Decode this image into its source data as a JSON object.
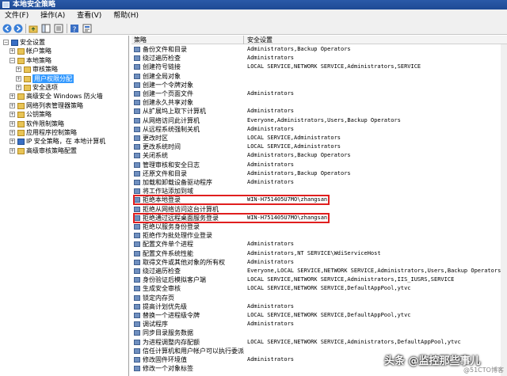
{
  "window": {
    "title": "本地安全策略"
  },
  "menu": [
    {
      "label": "文件(F)"
    },
    {
      "label": "操作(A)"
    },
    {
      "label": "查看(V)"
    },
    {
      "label": "帮助(H)"
    }
  ],
  "toolbar": {
    "icons": [
      "back-arrow",
      "forward-arrow",
      "up-folder",
      "show-tree",
      "export-list",
      "help",
      "properties"
    ]
  },
  "tree": [
    {
      "label": "安全设置",
      "level": 0,
      "expanded": true,
      "icon": "shield"
    },
    {
      "label": "帐户策略",
      "level": 1,
      "expanded": false,
      "icon": "folder"
    },
    {
      "label": "本地策略",
      "level": 1,
      "expanded": true,
      "icon": "folder"
    },
    {
      "label": "审核策略",
      "level": 2,
      "expanded": false,
      "icon": "folder"
    },
    {
      "label": "用户权限分配",
      "level": 2,
      "expanded": false,
      "icon": "folder",
      "selected": true
    },
    {
      "label": "安全选项",
      "level": 2,
      "expanded": false,
      "icon": "folder"
    },
    {
      "label": "高级安全 Windows 防火墙",
      "level": 1,
      "expanded": false,
      "icon": "folder"
    },
    {
      "label": "网络列表管理器策略",
      "level": 1,
      "expanded": false,
      "icon": "folder"
    },
    {
      "label": "公钥策略",
      "level": 1,
      "expanded": false,
      "icon": "folder"
    },
    {
      "label": "软件限制策略",
      "level": 1,
      "expanded": false,
      "icon": "folder"
    },
    {
      "label": "应用程序控制策略",
      "level": 1,
      "expanded": false,
      "icon": "folder"
    },
    {
      "label": "IP 安全策略，在 本地计算机",
      "level": 1,
      "expanded": false,
      "icon": "shield"
    },
    {
      "label": "高级审核策略配置",
      "level": 1,
      "expanded": false,
      "icon": "folder"
    }
  ],
  "list": {
    "columns": [
      "策略",
      "安全设置"
    ],
    "rows": [
      {
        "policy": "备份文件和目录",
        "setting": "Administrators,Backup Operators"
      },
      {
        "policy": "绕过遍历检查",
        "setting": "Administrators"
      },
      {
        "policy": "创建符号链接",
        "setting": "LOCAL SERVICE,NETWORK SERVICE,Administrators,SERVICE"
      },
      {
        "policy": "创建全局对象",
        "setting": ""
      },
      {
        "policy": "创建一个令牌对象",
        "setting": ""
      },
      {
        "policy": "创建一个页面文件",
        "setting": "Administrators"
      },
      {
        "policy": "创建永久共享对象",
        "setting": ""
      },
      {
        "policy": "从扩展坞上取下计算机",
        "setting": "Administrators"
      },
      {
        "policy": "从网络访问此计算机",
        "setting": "Everyone,Administrators,Users,Backup Operators"
      },
      {
        "policy": "从远程系统强制关机",
        "setting": "Administrators"
      },
      {
        "policy": "更改时区",
        "setting": "LOCAL SERVICE,Administrators"
      },
      {
        "policy": "更改系统时间",
        "setting": "LOCAL SERVICE,Administrators"
      },
      {
        "policy": "关闭系统",
        "setting": "Administrators,Backup Operators"
      },
      {
        "policy": "管理审核和安全日志",
        "setting": "Administrators"
      },
      {
        "policy": "还原文件和目录",
        "setting": "Administrators,Backup Operators"
      },
      {
        "policy": "加载和卸载设备驱动程序",
        "setting": "Administrators"
      },
      {
        "policy": "将工作站添加到域",
        "setting": ""
      },
      {
        "policy": "拒绝本地登录",
        "setting": "WIN-H751405U7MO\\zhangsan"
      },
      {
        "policy": "拒绝从网络访问这台计算机",
        "setting": ""
      },
      {
        "policy": "拒绝通过远程桌面服务登录",
        "setting": "WIN-H751405U7MO\\zhangsan"
      },
      {
        "policy": "拒绝以服务身份登录",
        "setting": ""
      },
      {
        "policy": "拒绝作为批处理作业登录",
        "setting": ""
      },
      {
        "policy": "配置文件单个进程",
        "setting": "Administrators"
      },
      {
        "policy": "配置文件系统性能",
        "setting": "Administrators,NT SERVICE\\WdiServiceHost"
      },
      {
        "policy": "取得文件或其他对象的所有权",
        "setting": "Administrators"
      },
      {
        "policy": "绕过遍历检查",
        "setting": "Everyone,LOCAL SERVICE,NETWORK SERVICE,Administrators,Users,Backup Operators"
      },
      {
        "policy": "身份验证后模拟客户端",
        "setting": "LOCAL SERVICE,NETWORK SERVICE,Administrators,IIS_IUSRS,SERVICE"
      },
      {
        "policy": "生成安全审核",
        "setting": "LOCAL SERVICE,NETWORK SERVICE,DefaultAppPool,ytvc"
      },
      {
        "policy": "锁定内存页",
        "setting": ""
      },
      {
        "policy": "提高计划优先级",
        "setting": "Administrators"
      },
      {
        "policy": "替换一个进程级令牌",
        "setting": "LOCAL SERVICE,NETWORK SERVICE,DefaultAppPool,ytvc"
      },
      {
        "policy": "调试程序",
        "setting": "Administrators"
      },
      {
        "policy": "同步目录服务数据",
        "setting": ""
      },
      {
        "policy": "为进程调整内存配额",
        "setting": "LOCAL SERVICE,NETWORK SERVICE,Administrators,DefaultAppPool,ytvc"
      },
      {
        "policy": "信任计算机和用户帐户可以执行委派",
        "setting": ""
      },
      {
        "policy": "修改固件环境值",
        "setting": "Administrators"
      },
      {
        "policy": "修改一个对象标签",
        "setting": ""
      }
    ]
  },
  "watermark": {
    "main": "头条 @监控那些事儿",
    "sub": "@51CTO博客"
  },
  "colors": {
    "highlight_box": "#e01e1e",
    "selection": "#3399ff",
    "titlebar": "#2b5aa8"
  }
}
